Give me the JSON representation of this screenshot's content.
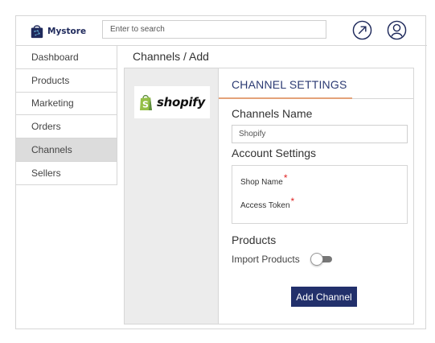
{
  "header": {
    "brand": "Mystore",
    "search_placeholder": "Enter to search"
  },
  "sidebar": {
    "items": [
      {
        "label": "Dashboard"
      },
      {
        "label": "Products"
      },
      {
        "label": "Marketing"
      },
      {
        "label": "Orders"
      },
      {
        "label": "Channels",
        "active": true
      },
      {
        "label": "Sellers"
      }
    ]
  },
  "breadcrumb": "Channels / Add",
  "channel_logo_text": "shopify",
  "settings": {
    "title": "CHANNEL SETTINGS",
    "channels_name_label": "Channels Name",
    "channels_name_value": "Shopify",
    "account_settings_label": "Account Settings",
    "fields": {
      "shop_name": "Shop Name",
      "access_token": "Access Token",
      "required_mark": "*"
    },
    "products_label": "Products",
    "import_products_label": "Import Products",
    "import_products_enabled": false,
    "add_button": "Add Channel"
  },
  "icons": {
    "brand": "shopping-bag-icon",
    "external": "external-link-icon",
    "user": "user-profile-icon"
  },
  "colors": {
    "primary": "#22306b",
    "tab_accent": "#e4a37a",
    "required": "#e02424",
    "shopify_green": "#95bf47"
  }
}
